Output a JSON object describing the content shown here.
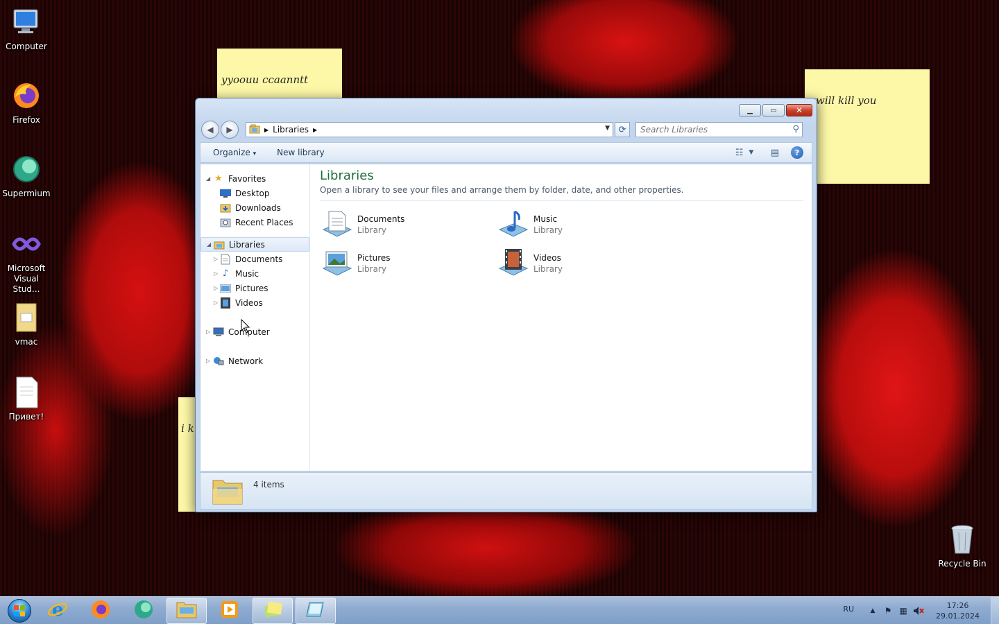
{
  "desktop": {
    "icons": [
      {
        "label": "Computer",
        "icon": "computer-icon"
      },
      {
        "label": "Firefox",
        "icon": "firefox-icon"
      },
      {
        "label": "Supermium",
        "icon": "supermium-icon"
      },
      {
        "label": "Microsoft Visual Stud...",
        "icon": "visual-studio-icon"
      },
      {
        "label": "vmac",
        "icon": "folder-icon"
      },
      {
        "label": "Привет!",
        "icon": "text-file-icon"
      },
      {
        "label": "Recycle Bin",
        "icon": "recycle-bin-icon"
      }
    ],
    "stickies": [
      {
        "text": "yyoouu  ccaanntt"
      },
      {
        "text": "will kill you"
      },
      {
        "text": "i k"
      }
    ]
  },
  "window": {
    "controls": {
      "minimize": "▁",
      "maximize": "▭",
      "close": "✕"
    },
    "address": {
      "crumbs": [
        "Libraries"
      ]
    },
    "search": {
      "placeholder": "Search Libraries"
    },
    "commands": {
      "organize": "Organize",
      "organize_arrow": "▾",
      "new_library": "New library"
    },
    "nav": {
      "favorites": {
        "label": "Favorites",
        "items": [
          "Desktop",
          "Downloads",
          "Recent Places"
        ]
      },
      "libraries": {
        "label": "Libraries",
        "items": [
          "Documents",
          "Music",
          "Pictures",
          "Videos"
        ]
      },
      "computer": "Computer",
      "network": "Network"
    },
    "content": {
      "title": "Libraries",
      "subtitle": "Open a library to see your files and arrange them by folder, date, and other properties.",
      "libraries": [
        {
          "name": "Documents",
          "type": "Library"
        },
        {
          "name": "Music",
          "type": "Library"
        },
        {
          "name": "Pictures",
          "type": "Library"
        },
        {
          "name": "Videos",
          "type": "Library"
        }
      ]
    },
    "details": {
      "count": "4 items"
    }
  },
  "taskbar": {
    "lang": "RU",
    "time": "17:26",
    "date": "29.01.2024"
  }
}
